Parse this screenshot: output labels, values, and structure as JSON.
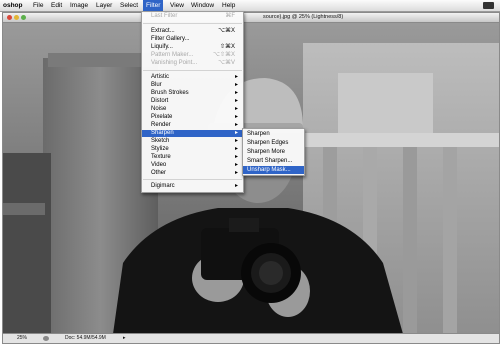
{
  "menubar": {
    "app": "oshop",
    "items": [
      "File",
      "Edit",
      "Image",
      "Layer",
      "Select",
      "Filter",
      "View",
      "Window",
      "Help"
    ],
    "active": "Filter"
  },
  "window": {
    "title": "source).jpg @ 25% (Lightness/8)",
    "zoom": "25%",
    "doc_info": "Doc: 54.9M/54.9M"
  },
  "filter_menu": {
    "last_filter": {
      "label": "Last Filter",
      "shortcut": "⌘F"
    },
    "extract": {
      "label": "Extract...",
      "shortcut": "⌥⌘X"
    },
    "filter_gallery": {
      "label": "Filter Gallery..."
    },
    "liquify": {
      "label": "Liquify...",
      "shortcut": "⇧⌘X"
    },
    "pattern_maker": {
      "label": "Pattern Maker...",
      "shortcut": "⌥⇧⌘X"
    },
    "vanishing_point": {
      "label": "Vanishing Point...",
      "shortcut": "⌥⌘V"
    },
    "groups": [
      "Artistic",
      "Blur",
      "Brush Strokes",
      "Distort",
      "Noise",
      "Pixelate",
      "Render",
      "Sharpen",
      "Sketch",
      "Stylize",
      "Texture",
      "Video",
      "Other"
    ],
    "digimarc": "Digimarc",
    "highlighted": "Sharpen"
  },
  "sharpen_submenu": {
    "items": [
      "Sharpen",
      "Sharpen Edges",
      "Sharpen More",
      "Smart Sharpen...",
      "Unsharp Mask..."
    ],
    "highlighted": "Unsharp Mask..."
  },
  "colors": {
    "highlight": "#2f64c7",
    "disabled_text": "#a8a8a8"
  }
}
